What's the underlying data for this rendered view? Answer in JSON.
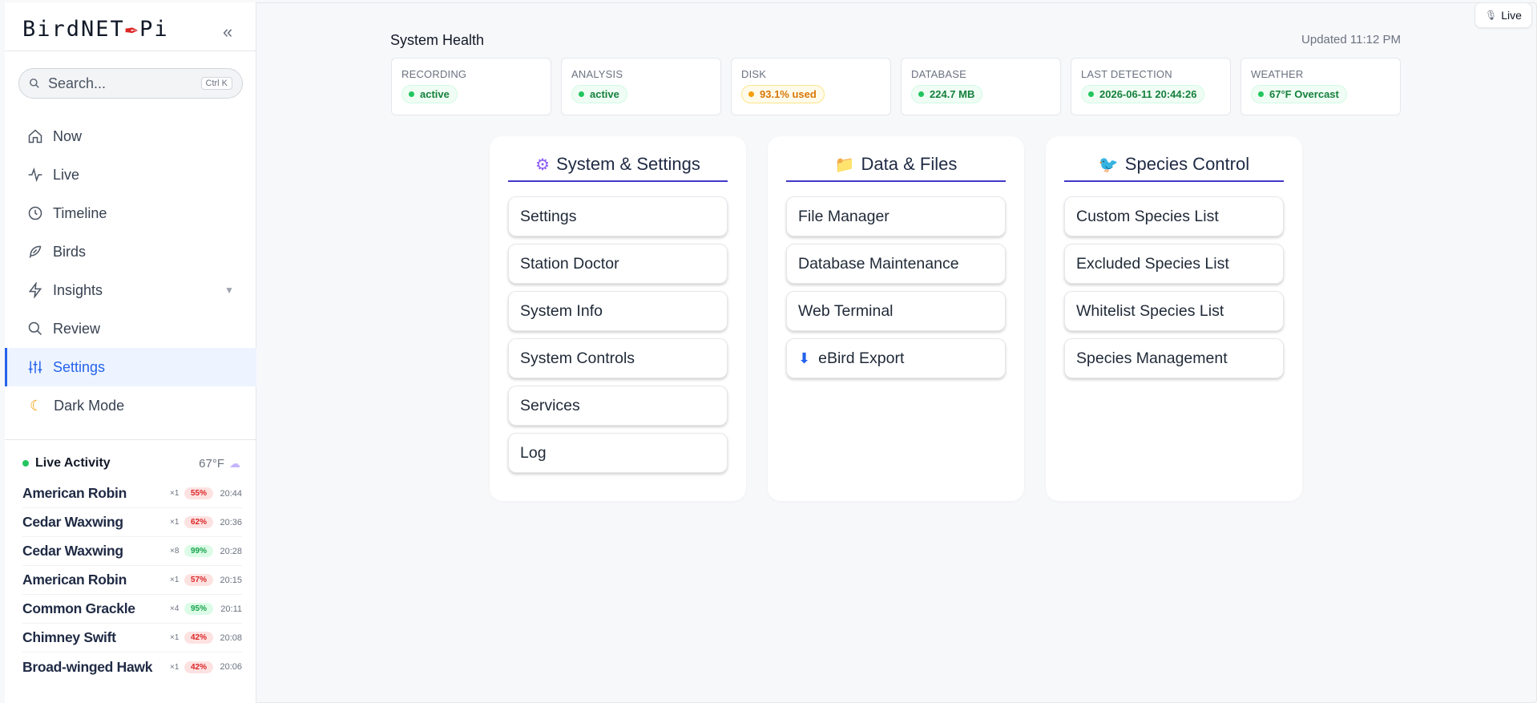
{
  "app": {
    "logo_left": "BirdNET",
    "logo_right": "Pi",
    "collapse_label": "«"
  },
  "search": {
    "placeholder": "Search...",
    "shortcut": "Ctrl K"
  },
  "nav": {
    "items": [
      {
        "label": "Now",
        "icon": "home-icon"
      },
      {
        "label": "Live",
        "icon": "activity-icon"
      },
      {
        "label": "Timeline",
        "icon": "clock-icon"
      },
      {
        "label": "Birds",
        "icon": "feather-icon"
      },
      {
        "label": "Insights",
        "icon": "lightning-icon"
      },
      {
        "label": "Review",
        "icon": "search-icon"
      },
      {
        "label": "Settings",
        "icon": "sliders-icon"
      },
      {
        "label": "Dark Mode",
        "icon": "moon-icon"
      }
    ],
    "active": "Settings"
  },
  "live_activity": {
    "title": "Live Activity",
    "temperature": "67°F",
    "rows": [
      {
        "name": "American Robin",
        "count": "×1",
        "confidence": "55%",
        "time": "20:44",
        "level": "low"
      },
      {
        "name": "Cedar Waxwing",
        "count": "×1",
        "confidence": "62%",
        "time": "20:36",
        "level": "low"
      },
      {
        "name": "Cedar Waxwing",
        "count": "×8",
        "confidence": "99%",
        "time": "20:28",
        "level": "high"
      },
      {
        "name": "American Robin",
        "count": "×1",
        "confidence": "57%",
        "time": "20:15",
        "level": "low"
      },
      {
        "name": "Common Grackle",
        "count": "×4",
        "confidence": "95%",
        "time": "20:11",
        "level": "high"
      },
      {
        "name": "Chimney Swift",
        "count": "×1",
        "confidence": "42%",
        "time": "20:08",
        "level": "low"
      },
      {
        "name": "Broad-winged Hawk",
        "count": "×1",
        "confidence": "42%",
        "time": "20:06",
        "level": "low"
      }
    ]
  },
  "live_badge": {
    "label": "Live"
  },
  "system_health": {
    "title": "System Health",
    "updated": "Updated 11:12 PM",
    "cards": [
      {
        "label": "RECORDING",
        "value": "active",
        "status": "ok"
      },
      {
        "label": "ANALYSIS",
        "value": "active",
        "status": "ok"
      },
      {
        "label": "DISK",
        "value": "93.1% used",
        "status": "warn"
      },
      {
        "label": "DATABASE",
        "value": "224.7 MB",
        "status": "ok"
      },
      {
        "label": "LAST DETECTION",
        "value": "2026-06-11 20:44:26",
        "status": "ok"
      },
      {
        "label": "WEATHER",
        "value": "67°F Overcast",
        "status": "ok"
      }
    ]
  },
  "sections": {
    "system": {
      "title": "System & Settings",
      "icon": "gear-icon",
      "items": [
        "Settings",
        "Station Doctor",
        "System Info",
        "System Controls",
        "Services",
        "Log"
      ]
    },
    "data": {
      "title": "Data & Files",
      "icon": "folder-icon",
      "items": [
        "File Manager",
        "Database Maintenance",
        "Web Terminal",
        "eBird Export"
      ]
    },
    "species": {
      "title": "Species Control",
      "icon": "bird-icon",
      "items": [
        "Custom Species List",
        "Excluded Species List",
        "Whitelist Species List",
        "Species Management"
      ]
    }
  },
  "colors": {
    "accent": "#2563eb",
    "section_underline": "#4338ca",
    "ok": "#22c55e",
    "warn": "#f59e0b",
    "low_conf": "#dc2626"
  }
}
